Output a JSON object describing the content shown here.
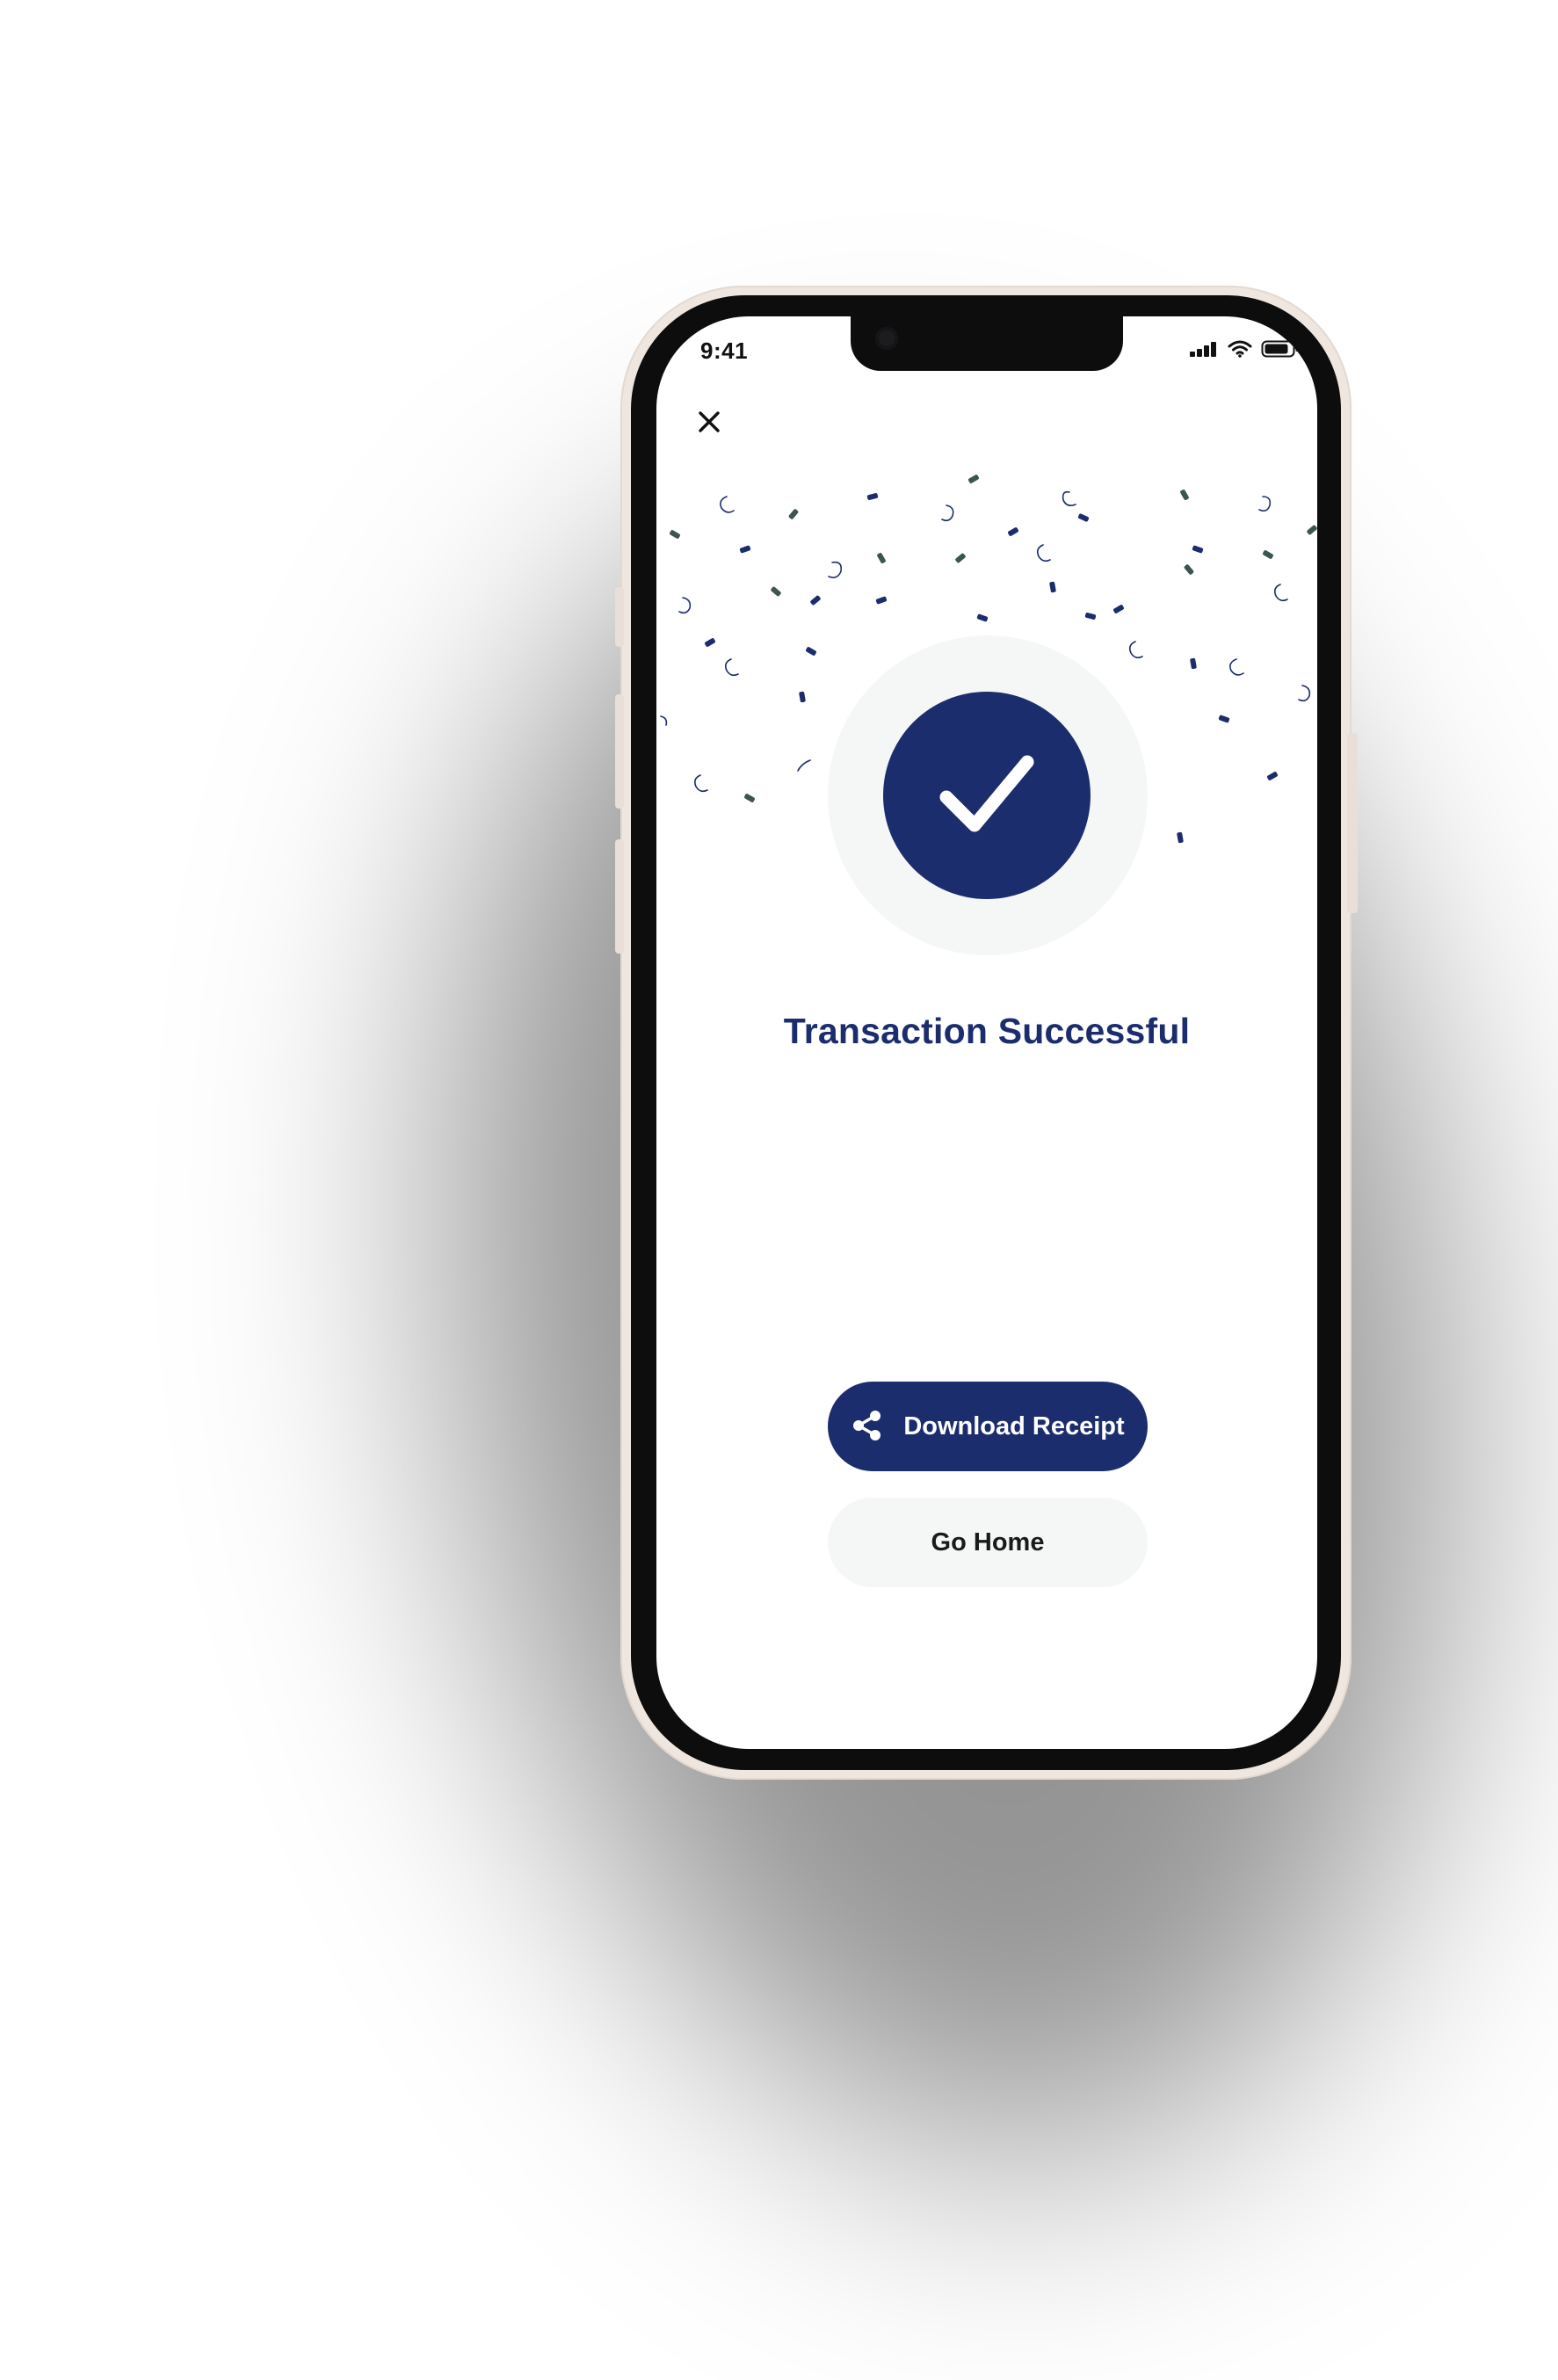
{
  "status_bar": {
    "time": "9:41",
    "icons": [
      "cellular-signal-icon",
      "wifi-icon",
      "battery-icon"
    ]
  },
  "header": {
    "close_icon": "close-icon"
  },
  "success": {
    "icon": "checkmark-icon",
    "title": "Transaction Successful"
  },
  "actions": {
    "download_receipt": {
      "label": "Download Receipt",
      "icon": "share-icon"
    },
    "go_home": {
      "label": "Go Home"
    }
  },
  "colors": {
    "primary": "#1c2d6e",
    "surface": "#f5f7f7",
    "confetti_dark": "#1c2d6e",
    "confetti_muted": "#3d5552",
    "phone_frame": "#efe6df"
  }
}
